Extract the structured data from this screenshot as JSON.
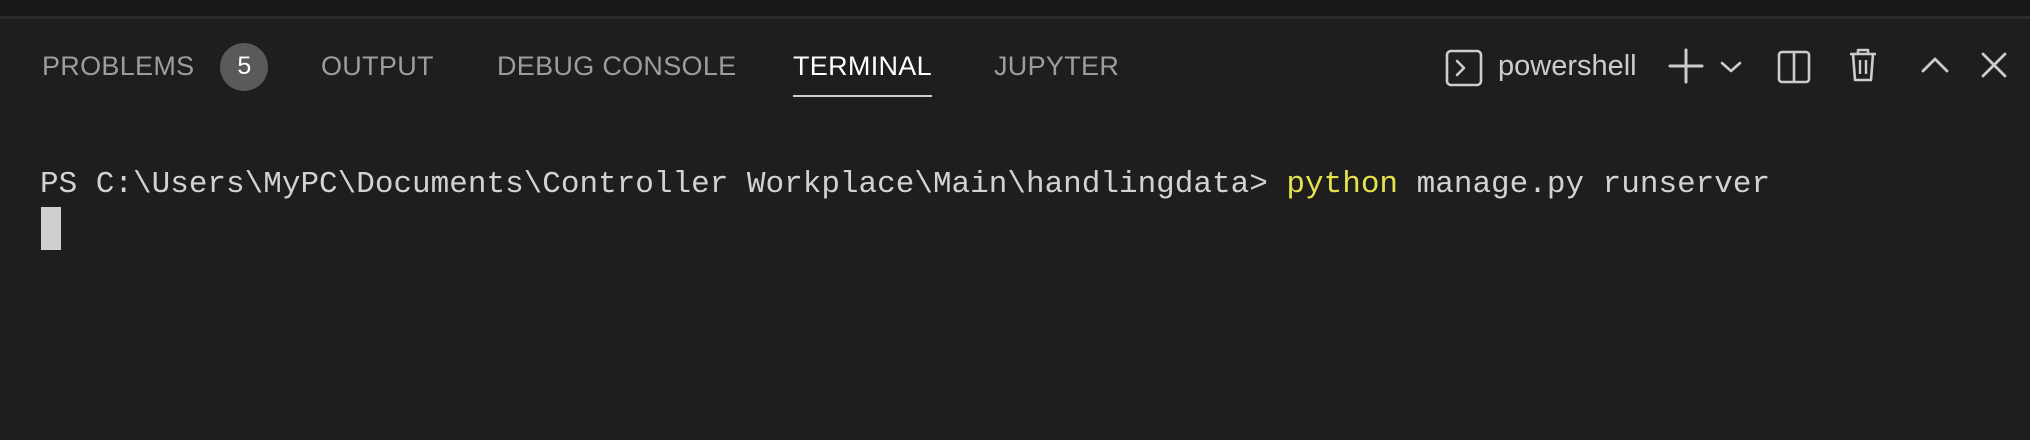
{
  "panel_tabs": [
    {
      "label": "PROBLEMS",
      "badge": "5",
      "active": false
    },
    {
      "label": "OUTPUT",
      "active": false
    },
    {
      "label": "DEBUG CONSOLE",
      "active": false
    },
    {
      "label": "TERMINAL",
      "active": true
    },
    {
      "label": "JUPYTER",
      "active": false
    }
  ],
  "toolbar": {
    "shell_name": "powershell",
    "icons": [
      "terminal-icon",
      "add-icon",
      "chevron-down-icon",
      "split-icon",
      "trash-icon",
      "chevron-up-icon",
      "close-icon"
    ]
  },
  "terminal": {
    "prompt": "PS C:\\Users\\MyPC\\Documents\\Controller Workplace\\Main\\handlingdata> ",
    "command_keyword": "python",
    "command_args": " manage.py runserver"
  },
  "colors": {
    "background": "#1e1e1e",
    "active_tab": "#ffffff",
    "inactive_tab": "#9d9d9d",
    "badge": "#5a5a5a",
    "command_keyword": "#e5e14b",
    "terminal_text": "#d2d2d2"
  }
}
